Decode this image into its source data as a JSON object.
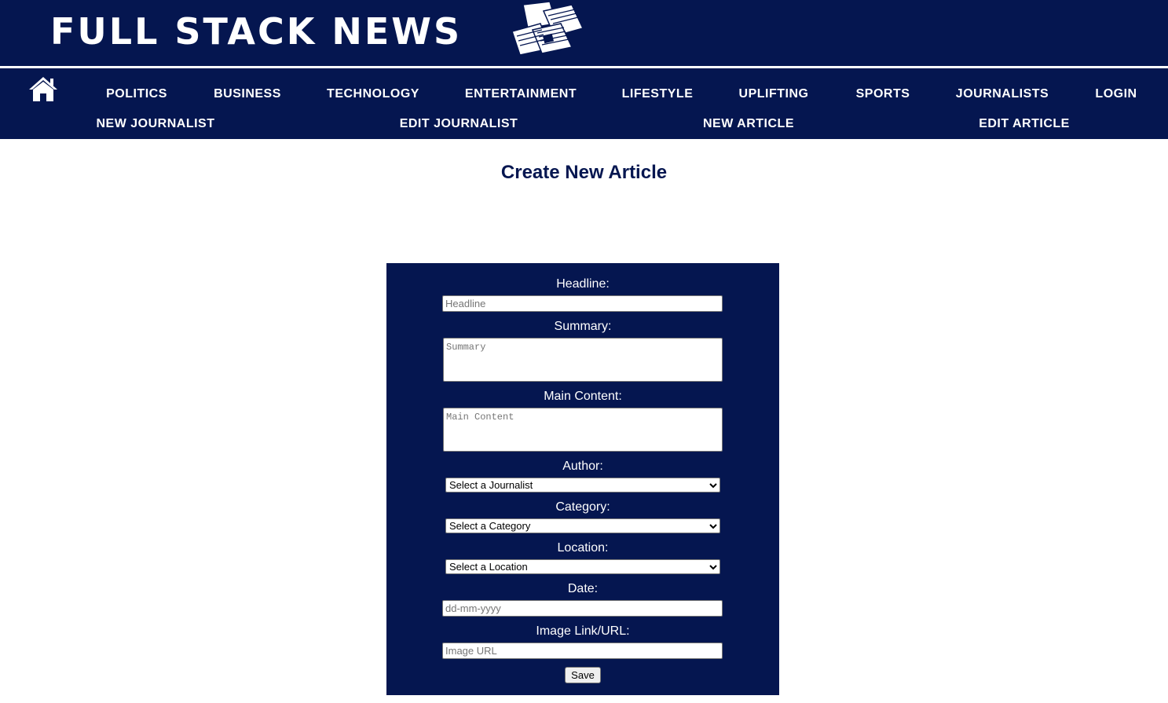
{
  "brand": {
    "title": "FULL STACK NEWS",
    "logo_icon": "newspapers-icon"
  },
  "colors": {
    "navy": "#051650",
    "white": "#ffffff"
  },
  "nav": {
    "home_icon": "home-icon",
    "row1": [
      {
        "id": "politics",
        "label": "POLITICS"
      },
      {
        "id": "business",
        "label": "BUSINESS"
      },
      {
        "id": "technology",
        "label": "TECHNOLOGY"
      },
      {
        "id": "entertainment",
        "label": "ENTERTAINMENT"
      },
      {
        "id": "lifestyle",
        "label": "LIFESTYLE"
      },
      {
        "id": "uplifting",
        "label": "UPLIFTING"
      },
      {
        "id": "sports",
        "label": "SPORTS"
      },
      {
        "id": "journalists",
        "label": "JOURNALISTS"
      },
      {
        "id": "login",
        "label": "LOGIN"
      }
    ],
    "row2": [
      {
        "id": "new-journalist",
        "label": "NEW JOURNALIST"
      },
      {
        "id": "edit-journalist",
        "label": "EDIT JOURNALIST"
      },
      {
        "id": "new-article",
        "label": "NEW ARTICLE"
      },
      {
        "id": "edit-article",
        "label": "EDIT ARTICLE"
      }
    ]
  },
  "page": {
    "title": "Create New Article"
  },
  "form": {
    "headline": {
      "label": "Headline:",
      "placeholder": "Headline",
      "value": ""
    },
    "summary": {
      "label": "Summary:",
      "placeholder": "Summary",
      "value": ""
    },
    "main_content": {
      "label": "Main Content:",
      "placeholder": "Main Content",
      "value": ""
    },
    "author": {
      "label": "Author:",
      "selected": "Select a Journalist"
    },
    "category": {
      "label": "Category:",
      "selected": "Select a Category"
    },
    "location": {
      "label": "Location:",
      "selected": "Select a Location"
    },
    "date": {
      "label": "Date:",
      "placeholder": "dd-mm-yyyy",
      "value": ""
    },
    "image_url": {
      "label": "Image Link/URL:",
      "placeholder": "Image URL",
      "value": ""
    },
    "save_label": "Save"
  }
}
